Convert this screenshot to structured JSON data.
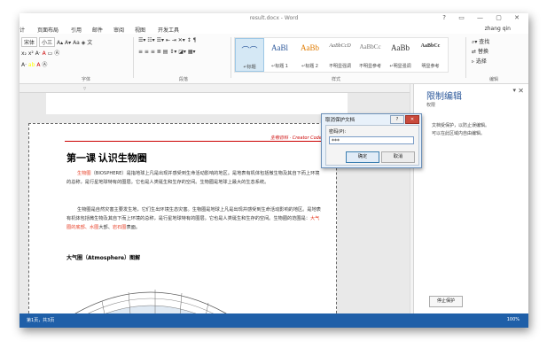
{
  "window": {
    "title": "result.docx - Word",
    "controls": "?  ▭  —  ▢  ✕"
  },
  "menubar": {
    "items": [
      "计",
      "页面布局",
      "引用",
      "邮件",
      "审阅",
      "视图",
      "开发工具"
    ],
    "user": "zhang qin"
  },
  "ribbon": {
    "font_name": "宋体",
    "font_size": "小三",
    "font_group_label": "字体",
    "paragraph_group_label": "段落",
    "styles_group_label": "样式",
    "editing_group_label": "编辑",
    "styles": [
      {
        "sample": "⌒⌒",
        "name": "↵标题"
      },
      {
        "sample": "AaBl",
        "name": "↵标题 1"
      },
      {
        "sample": "AaBb",
        "name": "↵标题 2"
      },
      {
        "sample": "AaBbCcD",
        "name": "不明显强调"
      },
      {
        "sample": "AaBbCc",
        "name": "不明显参考"
      },
      {
        "sample": "AaBb",
        "name": "↵明显强调"
      },
      {
        "sample": "AaBbCc",
        "name": "明显参考"
      }
    ],
    "editing": {
      "find": "查找",
      "replace": "替换",
      "select": "选择"
    }
  },
  "document": {
    "header": "生物百科 · Creator Codew",
    "title": "第一课 认识生物圈",
    "para1": {
      "lead": "生物圈",
      "text": "（BIOSPHERE）是指地球上凡是出现并感受到生命活动影响的地区。是地表有机体包括微生物及其自下而上环境的总称，是行星地球特有的圈层。它也是人类诞生和生存的空间。生物圈是地球上最大的生态系统。"
    },
    "para2": {
      "text": "生物圈是自然灾害主要发生地，它们生出环境生态灾害。生物圈是地球上凡是出现并感受到生命活动影响的地区。是地表有机体包括微生物及其自下而上环境的总称，是行星地球特有的圈层。它也是人类诞生和生存的空间。生物圈的范围是：",
      "highlight1": "大气圈的底部、",
      "highlight2": "水圈",
      "tail": "大部、",
      "highlight3": "岩石圈",
      "end": "表面。"
    },
    "subhead": "大气圈（Atmosphere）图解"
  },
  "taskpane": {
    "title": "限制编辑",
    "subtitle": "权限",
    "line1": "文档受保护，以防止误编辑。",
    "line2": "可以在此区域内自由编辑。",
    "stop_button": "停止保护"
  },
  "dialog": {
    "title": "取消保护文档",
    "help": "?",
    "close": "✕",
    "password_label": "密码(P):",
    "password_value": "***",
    "ok": "确定",
    "cancel": "取消"
  },
  "statusbar": {
    "left": "第1页，共3页",
    "right": "100%"
  }
}
